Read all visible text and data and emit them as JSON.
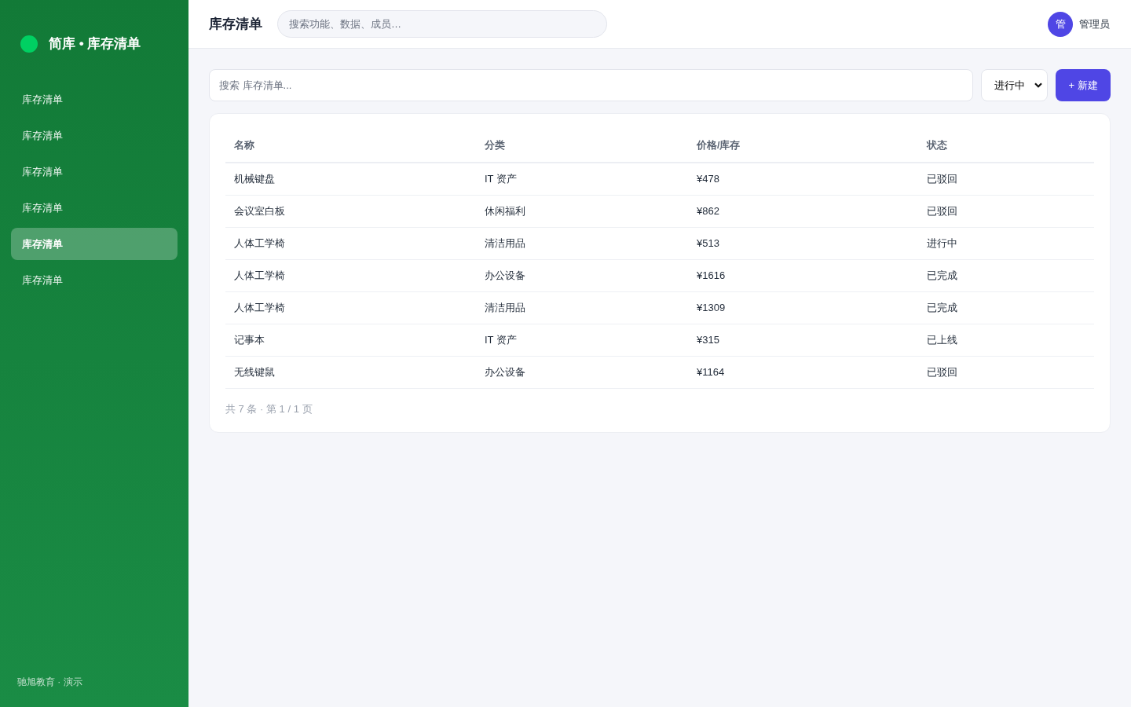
{
  "sidebar": {
    "brand": "简库 • 库存清单",
    "items": [
      {
        "label": "库存清单",
        "selected": false
      },
      {
        "label": "库存清单",
        "selected": false
      },
      {
        "label": "库存清单",
        "selected": false
      },
      {
        "label": "库存清单",
        "selected": false
      },
      {
        "label": "库存清单",
        "selected": true
      },
      {
        "label": "库存清单",
        "selected": false
      }
    ],
    "footer": "驰旭教育 · 演示"
  },
  "header": {
    "title": "库存清单",
    "search": {
      "placeholder": "搜索功能、数据、成员…"
    },
    "user": {
      "avatar": "管",
      "name": "管理员"
    }
  },
  "toolbar": {
    "search": {
      "placeholder": "搜索 库存清单..."
    },
    "filter": {
      "value": "进行中"
    },
    "new_button": "+ 新建"
  },
  "table": {
    "columns": [
      "名称",
      "分类",
      "价格/库存",
      "状态"
    ],
    "rows": [
      [
        "机械键盘",
        "IT 资产",
        "¥478",
        "已驳回"
      ],
      [
        "会议室白板",
        "休闲福利",
        "¥862",
        "已驳回"
      ],
      [
        "人体工学椅",
        "清洁用品",
        "¥513",
        "进行中"
      ],
      [
        "人体工学椅",
        "办公设备",
        "¥1616",
        "已完成"
      ],
      [
        "人体工学椅",
        "清洁用品",
        "¥1309",
        "已完成"
      ],
      [
        "记事本",
        "IT 资产",
        "¥315",
        "已上线"
      ],
      [
        "无线键鼠",
        "办公设备",
        "¥1164",
        "已驳回"
      ]
    ]
  },
  "pagination": "共 7 条 · 第 1 / 1 页"
}
